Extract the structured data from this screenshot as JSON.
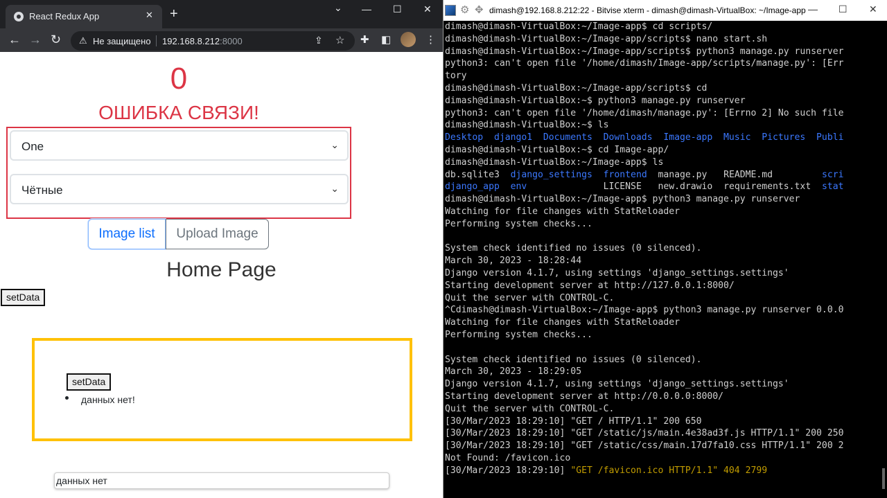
{
  "browser": {
    "tab_title": "React Redux App",
    "tab_close": "✕",
    "new_tab": "+",
    "window_controls": {
      "minimize": "—",
      "maximize": "☐",
      "close": "✕",
      "dropdown": "⌄"
    },
    "nav": {
      "back": "←",
      "forward": "→",
      "reload": "↻"
    },
    "security_label": "Не защищено",
    "url_host": "192.168.8.212",
    "url_port": ":8000",
    "icons": [
      "warning-icon",
      "share-icon",
      "star-icon",
      "extensions-icon",
      "sidepanel-icon",
      "avatar",
      "menu-icon"
    ]
  },
  "page": {
    "counter": "0",
    "error_text": "ОШИБКА СВЯЗИ!",
    "select_1": "One",
    "select_2": "Чётные",
    "tab_image_list": "Image list",
    "tab_upload": "Upload Image",
    "home_title": "Home Page",
    "setdata_button": "setData",
    "inner_setdata_button": "setData",
    "list_item": "данных нет!",
    "input_value": "данных нет",
    "colors": {
      "danger": "#dc3545",
      "warning": "#ffc107",
      "primary": "#0d6efd"
    }
  },
  "terminal": {
    "title": "dimash@192.168.8.212:22 - Bitvise xterm - dimash@dimash-VirtualBox: ~/Image-app",
    "window_controls": {
      "minimize": "—",
      "maximize": "☐",
      "close": "✕"
    },
    "lines": [
      [
        {
          "t": "dimash@dimash-VirtualBox:~/Image-app$ cd scripts/"
        }
      ],
      [
        {
          "t": "dimash@dimash-VirtualBox:~/Image-app/scripts$ nano start.sh"
        }
      ],
      [
        {
          "t": "dimash@dimash-VirtualBox:~/Image-app/scripts$ python3 manage.py runserver"
        }
      ],
      [
        {
          "t": "python3: can't open file '/home/dimash/Image-app/scripts/manage.py': [Err"
        }
      ],
      [
        {
          "t": "tory"
        }
      ],
      [
        {
          "t": "dimash@dimash-VirtualBox:~/Image-app/scripts$ cd"
        }
      ],
      [
        {
          "t": "dimash@dimash-VirtualBox:~$ python3 manage.py runserver"
        }
      ],
      [
        {
          "t": "python3: can't open file '/home/dimash/manage.py': [Errno 2] No such file"
        }
      ],
      [
        {
          "t": "dimash@dimash-VirtualBox:~$ ls"
        }
      ],
      [
        {
          "t": "Desktop  django1  Documents  Downloads  Image-app  Music  Pictures  Publi",
          "c": "blue"
        }
      ],
      [
        {
          "t": "dimash@dimash-VirtualBox:~$ cd Image-app/"
        }
      ],
      [
        {
          "t": "dimash@dimash-VirtualBox:~/Image-app$ ls"
        }
      ],
      [
        {
          "t": "db.sqlite3  "
        },
        {
          "t": "django_settings",
          "c": "blue"
        },
        {
          "t": "  "
        },
        {
          "t": "frontend",
          "c": "blue"
        },
        {
          "t": "  manage.py   README.md         "
        },
        {
          "t": "scri",
          "c": "blue"
        }
      ],
      [
        {
          "t": "django_app",
          "c": "blue"
        },
        {
          "t": "  "
        },
        {
          "t": "env",
          "c": "blue"
        },
        {
          "t": "              LICENSE   new.drawio  requirements.txt  "
        },
        {
          "t": "stat",
          "c": "blue"
        }
      ],
      [
        {
          "t": "dimash@dimash-VirtualBox:~/Image-app$ python3 manage.py runserver"
        }
      ],
      [
        {
          "t": "Watching for file changes with StatReloader"
        }
      ],
      [
        {
          "t": "Performing system checks..."
        }
      ],
      [
        {
          "t": ""
        }
      ],
      [
        {
          "t": "System check identified no issues (0 silenced)."
        }
      ],
      [
        {
          "t": "March 30, 2023 - 18:28:44"
        }
      ],
      [
        {
          "t": "Django version 4.1.7, using settings 'django_settings.settings'"
        }
      ],
      [
        {
          "t": "Starting development server at http://127.0.0.1:8000/"
        }
      ],
      [
        {
          "t": "Quit the server with CONTROL-C."
        }
      ],
      [
        {
          "t": "^Cdimash@dimash-VirtualBox:~/Image-app$ python3 manage.py runserver 0.0.0"
        }
      ],
      [
        {
          "t": "Watching for file changes with StatReloader"
        }
      ],
      [
        {
          "t": "Performing system checks..."
        }
      ],
      [
        {
          "t": ""
        }
      ],
      [
        {
          "t": "System check identified no issues (0 silenced)."
        }
      ],
      [
        {
          "t": "March 30, 2023 - 18:29:05"
        }
      ],
      [
        {
          "t": "Django version 4.1.7, using settings 'django_settings.settings'"
        }
      ],
      [
        {
          "t": "Starting development server at http://0.0.0.0:8000/"
        }
      ],
      [
        {
          "t": "Quit the server with CONTROL-C."
        }
      ],
      [
        {
          "t": "[30/Mar/2023 18:29:10] \"GET / HTTP/1.1\" 200 650"
        }
      ],
      [
        {
          "t": "[30/Mar/2023 18:29:10] \"GET /static/js/main.4e38ad3f.js HTTP/1.1\" 200 250"
        }
      ],
      [
        {
          "t": "[30/Mar/2023 18:29:10] \"GET /static/css/main.17d7fa10.css HTTP/1.1\" 200 2"
        }
      ],
      [
        {
          "t": "Not Found: /favicon.ico"
        }
      ],
      [
        {
          "t": "[30/Mar/2023 18:29:10] "
        },
        {
          "t": "\"GET /favicon.ico HTTP/1.1\" 404 2799",
          "c": "yellow"
        }
      ]
    ]
  }
}
